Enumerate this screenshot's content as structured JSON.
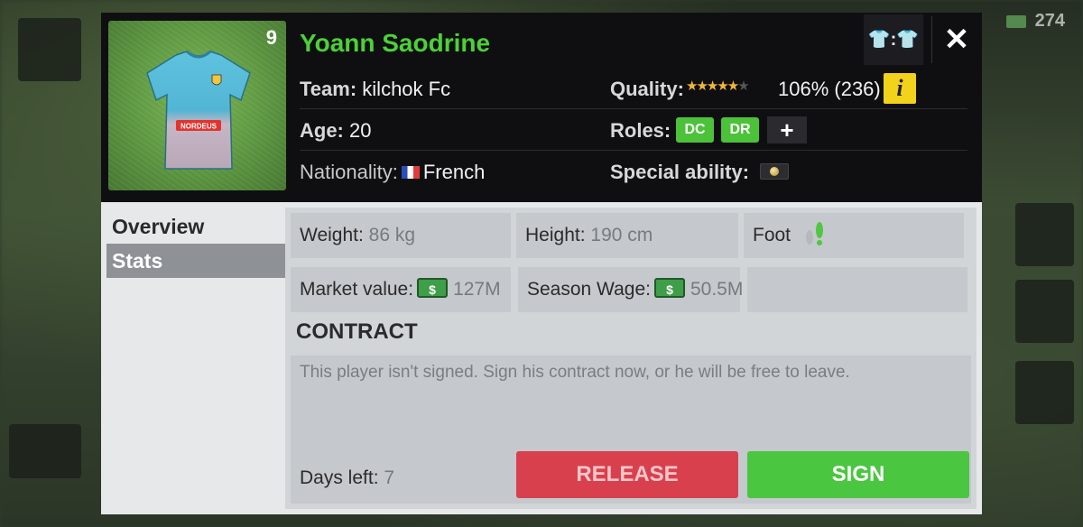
{
  "background": {
    "coins": "274"
  },
  "player": {
    "number": "9",
    "shirt_sponsor": "NORDEUS",
    "name": "Yoann Saodrine",
    "team_label": "Team:",
    "team": "kilchok Fc",
    "age_label": "Age:",
    "age": "20",
    "nationality_label": "Nationality:",
    "nationality": "French",
    "quality_label": "Quality:",
    "quality_value": "106% (236)",
    "quality_stars": 5,
    "quality_stars_max": 6,
    "roles_label": "Roles:",
    "roles": [
      "DC",
      "DR"
    ],
    "special_ability_label": "Special ability:"
  },
  "header_buttons": {
    "kit": "👕:👕",
    "close": "✕",
    "info": "i",
    "add_role": "+"
  },
  "tabs": [
    {
      "label": "Overview",
      "active": false
    },
    {
      "label": "Stats",
      "active": true
    }
  ],
  "details": {
    "weight_label": "Weight:",
    "weight": "86 kg",
    "height_label": "Height:",
    "height": "190 cm",
    "foot_label": "Foot",
    "market_value_label": "Market value:",
    "market_value": "127M",
    "season_wage_label": "Season Wage:",
    "season_wage": "50.5M"
  },
  "contract": {
    "title": "CONTRACT",
    "message": "This player isn't signed. Sign his contract now, or he will be free to leave.",
    "days_left_label": "Days left:",
    "days_left": "7",
    "release_label": "RELEASE",
    "sign_label": "SIGN"
  },
  "colors": {
    "accent_green": "#4cd137",
    "release_red": "#d8404e",
    "sign_green": "#4ac640",
    "info_yellow": "#f2d21a"
  }
}
